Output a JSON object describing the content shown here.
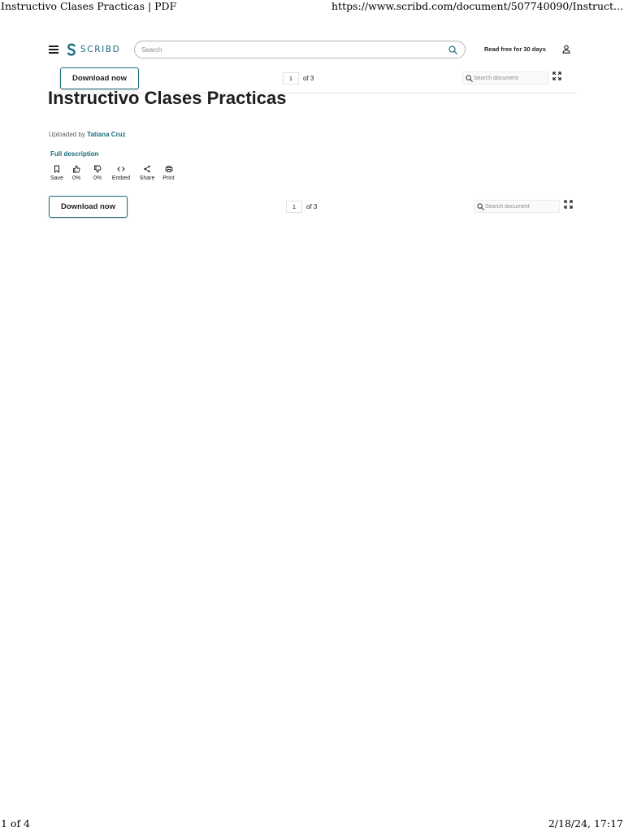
{
  "print": {
    "header_title": "Instructivo Clases Practicas | PDF",
    "header_url": "https://www.scribd.com/document/507740090/Instruct...",
    "footer_page": "1 of 4",
    "footer_date": "2/18/24, 17:17"
  },
  "nav": {
    "logo_text": "SCRIBD",
    "search_placeholder": "Search",
    "read_free": "Read free for 30 days"
  },
  "toolbar": {
    "download_label": "Download now",
    "page_current": "1",
    "page_total": "of 3",
    "search_doc_placeholder": "Search document"
  },
  "document": {
    "title": "Instructivo Clases Practicas",
    "uploaded_prefix": "Uploaded by",
    "author": "Tatiana Cruz",
    "full_description": "Full description"
  },
  "actions": {
    "save": "Save",
    "like_pct": "0%",
    "dislike_pct": "0%",
    "embed": "Embed",
    "share": "Share",
    "print": "Print"
  },
  "colors": {
    "brand": "#1a6b7c",
    "text": "#1e1e1e"
  },
  "icons": [
    "menu-icon",
    "scribd-logo-icon",
    "search-icon",
    "user-icon",
    "expand-icon",
    "bookmark-icon",
    "thumbs-up-icon",
    "thumbs-down-icon",
    "code-icon",
    "share-icon",
    "print-icon"
  ]
}
